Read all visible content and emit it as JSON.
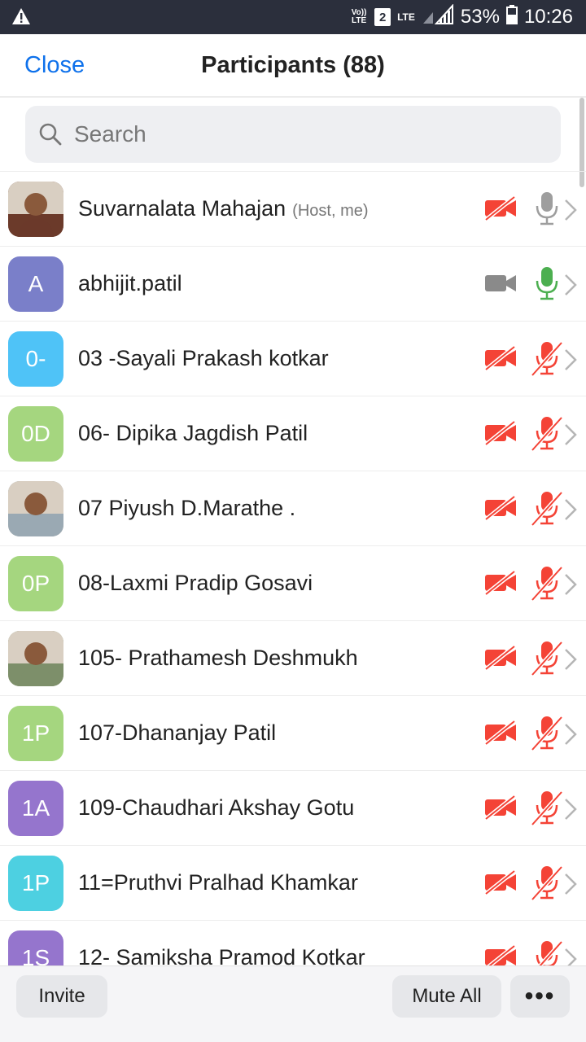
{
  "status_bar": {
    "volte": "Vo)) LTE",
    "sim": "2",
    "lte": "LTE",
    "battery": "53%",
    "time": "10:26"
  },
  "header": {
    "close_label": "Close",
    "title": "Participants (88)"
  },
  "search": {
    "placeholder": "Search",
    "value": ""
  },
  "participants": [
    {
      "name": "Suvarnalata Mahajan",
      "role": "(Host, me)",
      "initials": "",
      "avatar_color": "#6b3a2a",
      "photo": true,
      "video": "off",
      "audio": "on-idle"
    },
    {
      "name": "abhijit.patil",
      "role": "",
      "initials": "A",
      "avatar_color": "#7a7fc9",
      "photo": false,
      "video": "on",
      "audio": "speaking"
    },
    {
      "name": "03 -Sayali  Prakash kotkar",
      "role": "",
      "initials": "0-",
      "avatar_color": "#4fc3f7",
      "photo": false,
      "video": "off",
      "audio": "muted"
    },
    {
      "name": "06- Dipika Jagdish Patil",
      "role": "",
      "initials": "0D",
      "avatar_color": "#a5d67f",
      "photo": false,
      "video": "off",
      "audio": "muted"
    },
    {
      "name": "07 Piyush D.Marathe .",
      "role": "",
      "initials": "",
      "avatar_color": "#9aa9b3",
      "photo": true,
      "video": "off",
      "audio": "muted"
    },
    {
      "name": "08-Laxmi Pradip Gosavi",
      "role": "",
      "initials": "0P",
      "avatar_color": "#a5d67f",
      "photo": false,
      "video": "off",
      "audio": "muted"
    },
    {
      "name": "105- Prathamesh Deshmukh",
      "role": "",
      "initials": "",
      "avatar_color": "#7d8f6a",
      "photo": true,
      "video": "off",
      "audio": "muted"
    },
    {
      "name": "107-Dhananjay Patil",
      "role": "",
      "initials": "1P",
      "avatar_color": "#a5d67f",
      "photo": false,
      "video": "off",
      "audio": "muted"
    },
    {
      "name": "109-Chaudhari Akshay Gotu",
      "role": "",
      "initials": "1A",
      "avatar_color": "#9575cd",
      "photo": false,
      "video": "off",
      "audio": "muted"
    },
    {
      "name": "11=Pruthvi Pralhad Khamkar",
      "role": "",
      "initials": "1P",
      "avatar_color": "#4dd0e1",
      "photo": false,
      "video": "off",
      "audio": "muted"
    },
    {
      "name": "12- Samiksha Pramod Kotkar",
      "role": "",
      "initials": "1S",
      "avatar_color": "#9575cd",
      "photo": false,
      "video": "off",
      "audio": "muted"
    }
  ],
  "bottom_bar": {
    "invite_label": "Invite",
    "mute_all_label": "Mute All",
    "more_label": "•••"
  },
  "colors": {
    "accent": "#0e71eb",
    "muted_red": "#f44336",
    "speaking_green": "#4caf50",
    "idle_gray": "#9e9e9e"
  }
}
